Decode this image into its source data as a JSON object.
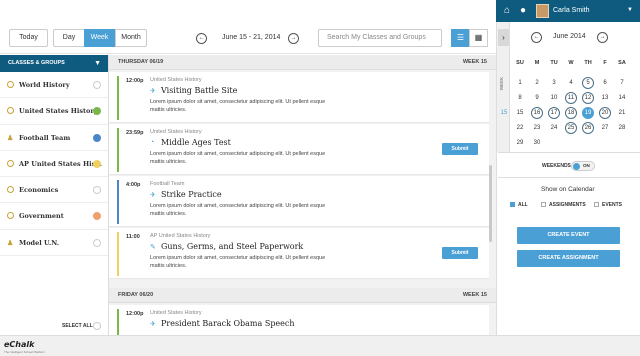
{
  "header": {
    "user_name": "Carla Smith",
    "icons": [
      "home-icon",
      "bell-icon",
      "user-avatar",
      "chevron-down-icon"
    ]
  },
  "toolbar": {
    "today_label": "Today",
    "day_label": "Day",
    "week_label": "Week",
    "month_label": "Month",
    "date_range": "June 15 - 21, 2014",
    "search_placeholder": "Search My Classes and Groups"
  },
  "sidebar": {
    "title": "CLASSES & GROUPS",
    "items": [
      {
        "label": "World History",
        "icon": "class-icon",
        "dot_color": ""
      },
      {
        "label": "United States History",
        "icon": "class-icon",
        "dot_color": "#7ab648"
      },
      {
        "label": "Football Team",
        "icon": "team-icon",
        "dot_color": "#4a86c8"
      },
      {
        "label": "AP United States His...",
        "icon": "class-icon",
        "dot_color": "#f0d060"
      },
      {
        "label": "Economics",
        "icon": "class-icon",
        "dot_color": ""
      },
      {
        "label": "Government",
        "icon": "class-icon",
        "dot_color": "#f0a070"
      },
      {
        "label": "Model U.N.",
        "icon": "team-icon",
        "dot_color": ""
      }
    ],
    "select_all": "SELECT ALL"
  },
  "agenda": {
    "days": [
      {
        "label": "THURSDAY 06/19",
        "week": "WEEK 15",
        "events": [
          {
            "time": "12:00p",
            "course": "United States History",
            "title": "Visiting Battle Site",
            "desc": "Lorem ipsum dolor sit amet, consectetur adipiscing elit. Ut pellent esque mattis ultricies.",
            "bar_color": "#7ab648",
            "icon": "calendar-icon",
            "submit": ""
          },
          {
            "time": "23:59p",
            "course": "United States History",
            "title": "Middle Ages Test",
            "desc": "Lorem ipsum dolor sit amet, consectetur adipiscing elit. Ut pellent esque mattis ultricies.",
            "bar_color": "#7ab648",
            "icon": "check-icon",
            "submit": "Submit"
          },
          {
            "time": "4:00p",
            "course": "Football Team",
            "title": "Strike Practice",
            "desc": "Lorem ipsum dolor sit amet, consectetur adipiscing elit. Ut pellent esque mattis ultricies.",
            "bar_color": "#4a86c8",
            "icon": "calendar-icon",
            "submit": ""
          },
          {
            "time": "11:00",
            "course": "AP United States History",
            "title": "Guns, Germs, and Steel Paperwork",
            "desc": "Lorem ipsum dolor sit amet, consectetur adipiscing elit. Ut pellent esque mattis ultricies.",
            "bar_color": "#f0d060",
            "icon": "assignment-icon",
            "submit": "Submit"
          }
        ]
      },
      {
        "label": "FRIDAY 06/20",
        "week": "WEEK 15",
        "events": [
          {
            "time": "12:00p",
            "course": "United States History",
            "title": "President Barack Obama Speech",
            "desc": "",
            "bar_color": "#7ab648",
            "icon": "calendar-icon",
            "submit": ""
          }
        ]
      }
    ]
  },
  "mini_calendar": {
    "month": "June 2014",
    "side_label": "WEEK",
    "dow": [
      "SU",
      "M",
      "TU",
      "W",
      "TH",
      "F",
      "SA"
    ],
    "weeks": [
      {
        "num": "",
        "days": [
          "1",
          "2",
          "3",
          "4",
          "5",
          "6",
          "7"
        ]
      },
      {
        "num": "",
        "days": [
          "8",
          "9",
          "10",
          "11",
          "12",
          "13",
          "14"
        ]
      },
      {
        "num": "15",
        "days": [
          "15",
          "16",
          "17",
          "18",
          "19",
          "20",
          "21"
        ]
      },
      {
        "num": "",
        "days": [
          "22",
          "23",
          "24",
          "25",
          "26",
          "27",
          "28"
        ]
      },
      {
        "num": "",
        "days": [
          "29",
          "30",
          "",
          "",
          "",
          "",
          ""
        ]
      }
    ],
    "ringed": [
      "5",
      "11",
      "12",
      "16",
      "17",
      "18",
      "20",
      "25",
      "26"
    ],
    "today": "19"
  },
  "options": {
    "weekends_label": "WEEKENDS",
    "toggle_label": "ON",
    "show_on_calendar": "Show on Calendar",
    "filters": [
      {
        "label": "ALL",
        "checked": true
      },
      {
        "label": "ASSIGNMENTS",
        "checked": false
      },
      {
        "label": "EVENTS",
        "checked": false
      }
    ],
    "create_event": "CREATE EVENT",
    "create_assignment": "CREATE ASSIGNMENT"
  },
  "footer": {
    "logo": "eChalk",
    "tagline": "The Intelligent School Platform"
  }
}
